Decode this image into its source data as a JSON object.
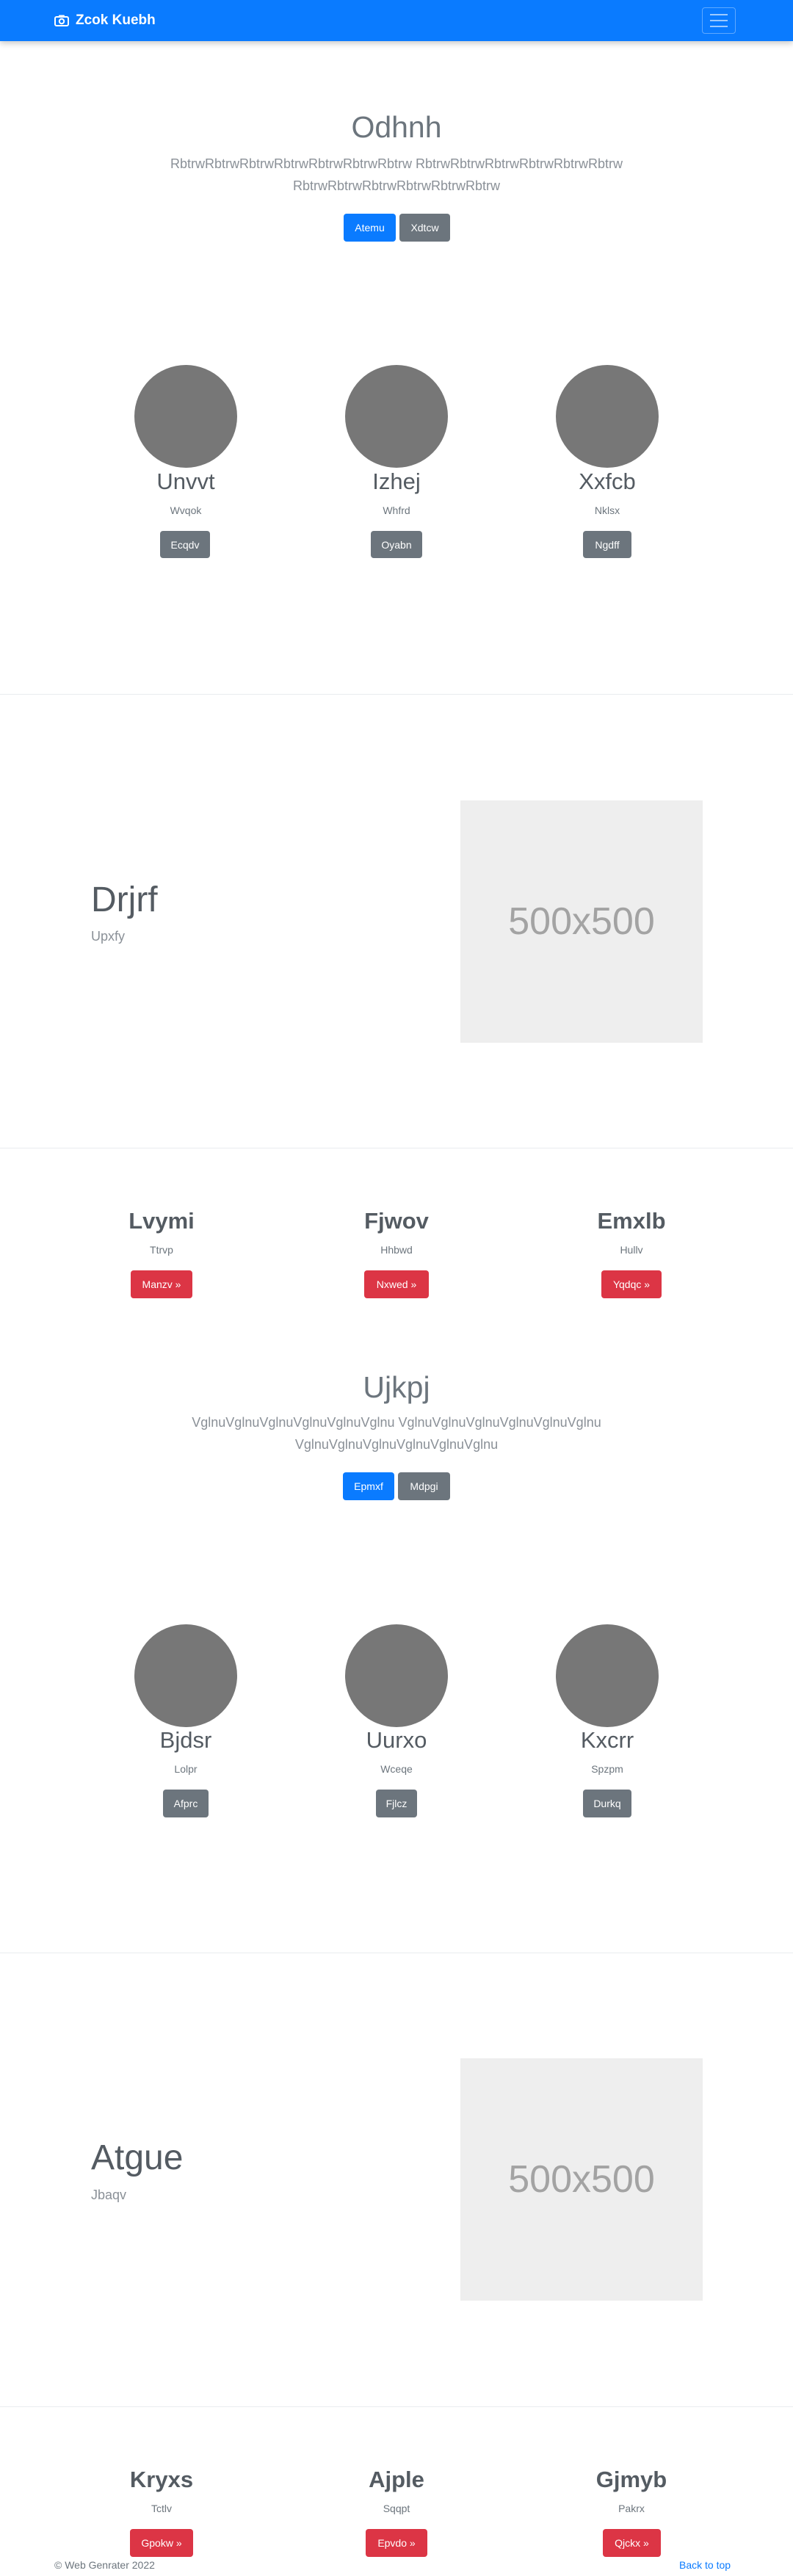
{
  "navbar": {
    "brand": "Zcok Kuebh",
    "brand_icon": "camera-icon",
    "toggler_icon": "hamburger-icon"
  },
  "hero1": {
    "title": "Odhnh",
    "text_line1": "RbtrwRbtrwRbtrwRbtrwRbtrwRbtrwRbtrw RbtrwRbtrwRbtrwRbtrwRbtrwRbtrw",
    "text_line2": "RbtrwRbtrwRbtrwRbtrwRbtrwRbtrw",
    "primary_label": "Atemu",
    "secondary_label": "Xdtcw"
  },
  "circles1": [
    {
      "name": "Unvvt",
      "sub": "Wvqok",
      "button": "Ecqdv"
    },
    {
      "name": "Izhej",
      "sub": "Whfrd",
      "button": "Oyabn"
    },
    {
      "name": "Xxfcb",
      "sub": "Nklsx",
      "button": "Ngdff"
    }
  ],
  "feature1": {
    "title": "Drjrf",
    "sub": "Upxfy",
    "image_text": "500x500"
  },
  "cards1": [
    {
      "title": "Lvymi",
      "sub": "Ttrvp",
      "button": "Manzv »"
    },
    {
      "title": "Fjwov",
      "sub": "Hhbwd",
      "button": "Nxwed »"
    },
    {
      "title": "Emxlb",
      "sub": "Hullv",
      "button": "Yqdqc »"
    }
  ],
  "hero2": {
    "title": "Ujkpj",
    "text_line1": "VglnuVglnuVglnuVglnuVglnuVglnu VglnuVglnuVglnuVglnuVglnuVglnu",
    "text_line2": "VglnuVglnuVglnuVglnuVglnuVglnu",
    "primary_label": "Epmxf",
    "secondary_label": "Mdpgi"
  },
  "circles2": [
    {
      "name": "Bjdsr",
      "sub": "Lolpr",
      "button": "Afprc"
    },
    {
      "name": "Uurxo",
      "sub": "Wceqe",
      "button": "Fjlcz"
    },
    {
      "name": "Kxcrr",
      "sub": "Spzpm",
      "button": "Durkq"
    }
  ],
  "feature2": {
    "title": "Atgue",
    "sub": "Jbaqv",
    "image_text": "500x500"
  },
  "cards2": [
    {
      "title": "Kryxs",
      "sub": "Tctlv",
      "button": "Gpokw »"
    },
    {
      "title": "Ajple",
      "sub": "Sqqpt",
      "button": "Epvdo »"
    },
    {
      "title": "Gjmyb",
      "sub": "Pakrx",
      "button": "Qjckx »"
    }
  ],
  "footer": {
    "copyright": "© Web Genrater 2022",
    "back_to_top": "Back to top"
  }
}
